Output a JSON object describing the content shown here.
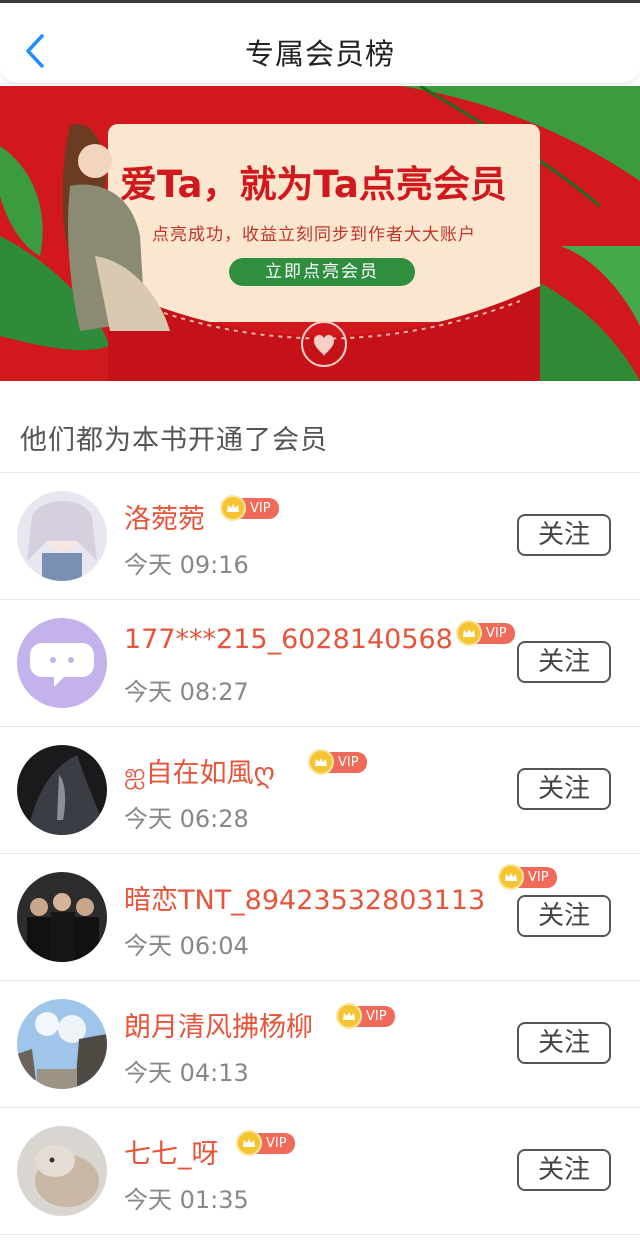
{
  "header": {
    "title": "专属会员榜",
    "back_icon": "chevron-left-icon"
  },
  "banner": {
    "headline": "爱Ta，就为Ta点亮会员",
    "subline": "点亮成功，收益立刻同步到作者大大账户",
    "cta_label": "立即点亮会员",
    "colors": {
      "background": "#d1181d",
      "card": "#fbe6cf",
      "cta": "#2f8f3f"
    }
  },
  "section": {
    "title": "他们都为本书开通了会员"
  },
  "members": [
    {
      "name": "洛菀菀",
      "badge": "VIP",
      "time": "今天 09:16",
      "follow_label": "关注"
    },
    {
      "name": "177***215_6028140568",
      "badge": "VIP",
      "time": "今天 08:27",
      "follow_label": "关注"
    },
    {
      "name": "ஐ自在如風ღ",
      "badge": "VIP",
      "time": "今天 06:28",
      "follow_label": "关注"
    },
    {
      "name": "暗恋TNT_89423532803113",
      "badge": "VIP",
      "time": "今天 06:04",
      "follow_label": "关注"
    },
    {
      "name": "朗月清风拂杨柳",
      "badge": "VIP",
      "time": "今天 04:13",
      "follow_label": "关注"
    },
    {
      "name": "七七_呀",
      "badge": "VIP",
      "time": "今天 01:35",
      "follow_label": "关注"
    }
  ],
  "colors": {
    "name": "#e6553a",
    "vip": "#f06a5a",
    "crown": "#f5c531",
    "back": "#1e90ff"
  }
}
